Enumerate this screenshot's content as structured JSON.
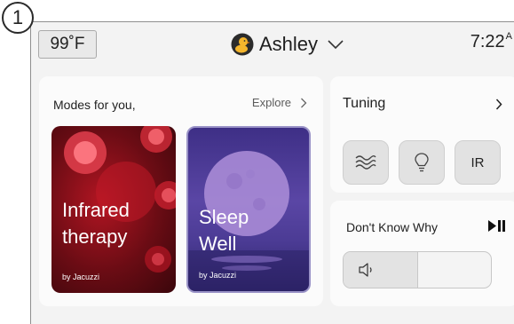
{
  "step_badge": "1",
  "status_bar": {
    "temperature": "99˚F",
    "user_name": "Ashley",
    "time": "7:22",
    "time_suffix": "A"
  },
  "modes": {
    "title": "Modes for you,",
    "explore_label": "Explore",
    "tiles": [
      {
        "line1": "Infrared",
        "line2": "therapy",
        "byline": "by Jacuzzi"
      },
      {
        "line1": "Sleep",
        "line2": "Well",
        "byline": "by Jacuzzi"
      }
    ]
  },
  "tuning": {
    "title": "Tuning",
    "buttons": [
      {
        "icon": "heat-waves-icon"
      },
      {
        "icon": "light-bulb-icon"
      },
      {
        "label": "IR"
      }
    ]
  },
  "now_playing": {
    "song_title": "Don't Know Why",
    "volume_fraction": 0.5
  },
  "colors": {
    "panel_background": "#f3f3f3",
    "card_background": "#fbfbfb",
    "button_gray": "#e2e2e2",
    "infrared_red": "#b11522",
    "sleep_purple": "#4b3b94"
  }
}
